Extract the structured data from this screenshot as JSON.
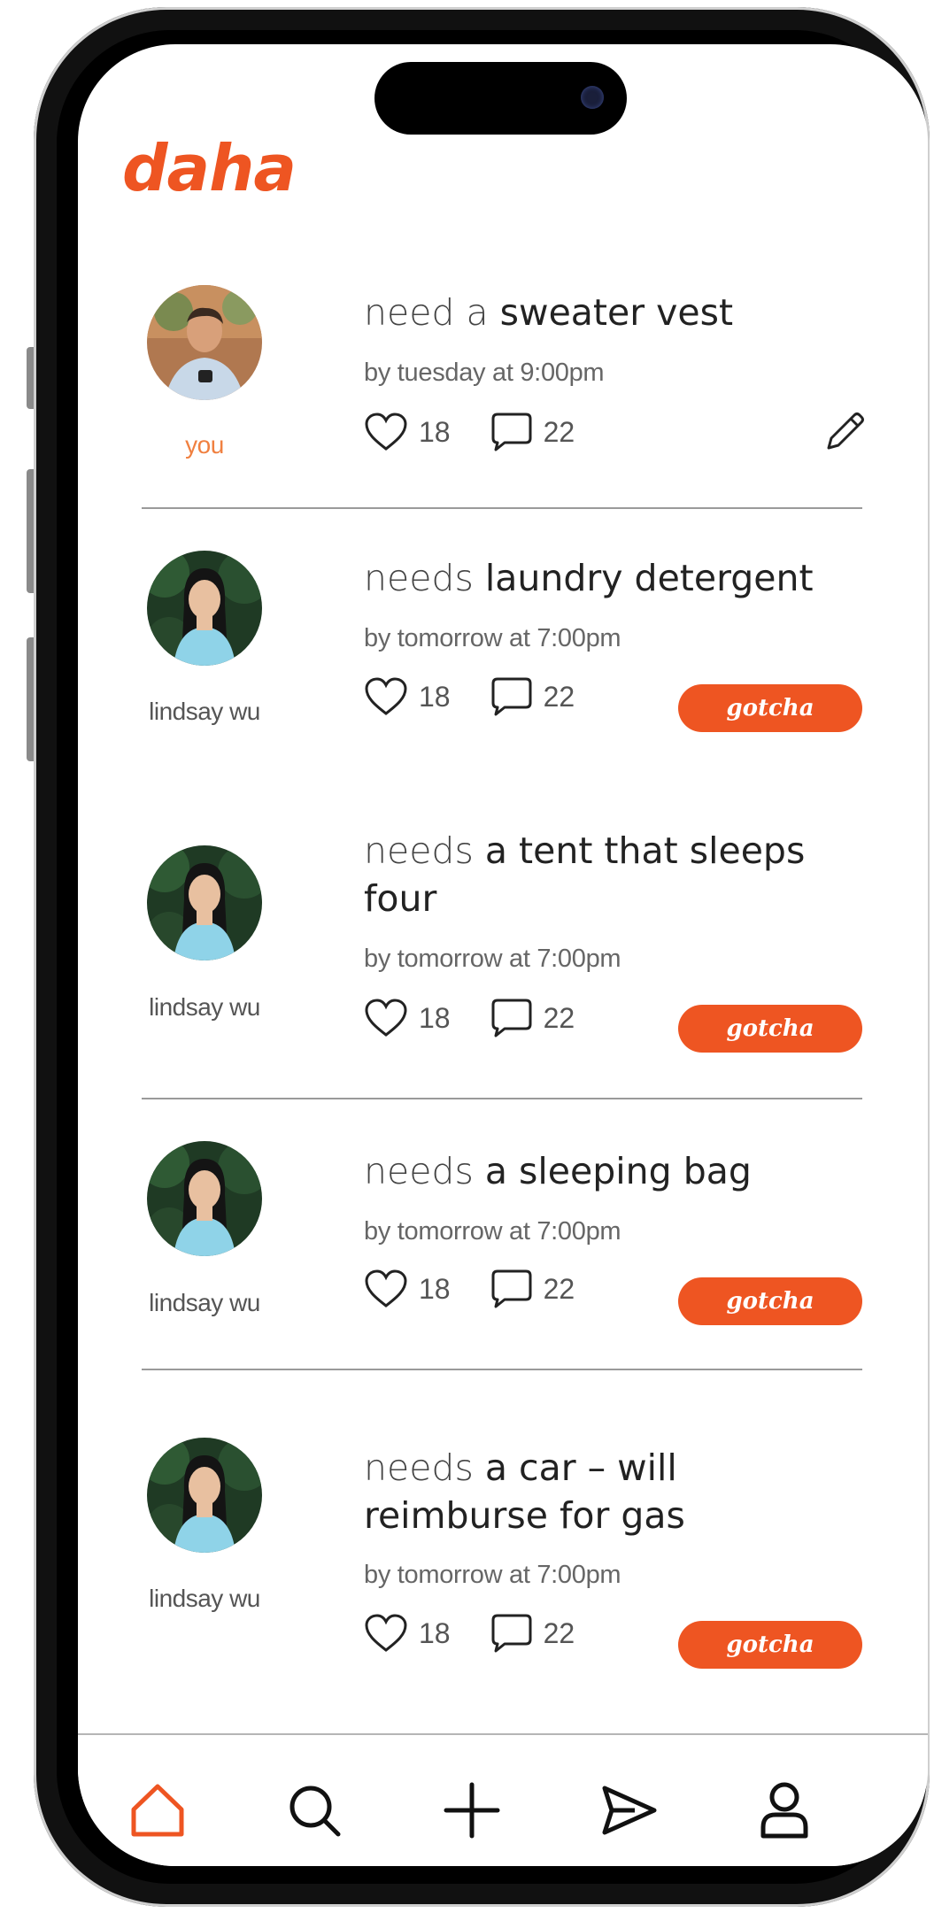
{
  "app": {
    "logo": "daha",
    "accent": "#ee5522"
  },
  "posts": [
    {
      "author": "you",
      "verb": "need a",
      "item": "sweater vest",
      "deadline": "by tuesday at 9:00pm",
      "likes": "18",
      "comments": "22",
      "action": "edit-icon"
    },
    {
      "author": "lindsay wu",
      "verb": "needs",
      "item": "laundry detergent",
      "deadline": "by tomorrow at 7:00pm",
      "likes": "18",
      "comments": "22",
      "action_label": "gotcha"
    },
    {
      "author": "lindsay wu",
      "verb": "needs",
      "item": "a tent that sleeps four",
      "deadline": "by tomorrow at 7:00pm",
      "likes": "18",
      "comments": "22",
      "action_label": "gotcha"
    },
    {
      "author": "lindsay wu",
      "verb": "needs",
      "item": "a sleeping bag",
      "deadline": "by tomorrow at 7:00pm",
      "likes": "18",
      "comments": "22",
      "action_label": "gotcha"
    },
    {
      "author": "lindsay wu",
      "verb": "needs",
      "item": "a car – will reimburse for gas",
      "deadline": "by tomorrow at 7:00pm",
      "likes": "18",
      "comments": "22",
      "action_label": "gotcha"
    }
  ],
  "tabbar": [
    {
      "icon": "home-icon",
      "active": true
    },
    {
      "icon": "search-icon",
      "active": false
    },
    {
      "icon": "plus-icon",
      "active": false
    },
    {
      "icon": "send-icon",
      "active": false
    },
    {
      "icon": "profile-icon",
      "active": false
    }
  ]
}
